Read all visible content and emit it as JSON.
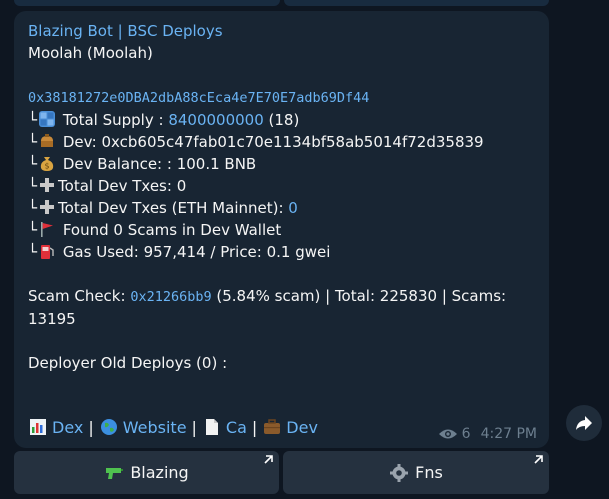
{
  "message": {
    "bot_name": "Blazing Bot | BSC Deploys",
    "token_name": "Moolah (Moolah)",
    "contract_address": "0x38181272e0DBA2dbA88cEca4e7E70E7adb69Df44",
    "tree_mark": "└",
    "lines": {
      "total_supply_label": "Total Supply : ",
      "total_supply_value": "8400000000",
      "total_supply_suffix": " (18)",
      "dev_label": "Dev: ",
      "dev_value": "0xcb605c47fab01c70e1134bf58ab5014f72d35839",
      "dev_balance_label": "Dev Balance: ",
      "dev_balance_value": ": 100.1 BNB",
      "total_dev_txes_label": "Total Dev Txes: ",
      "total_dev_txes_value": "0",
      "total_dev_txes_eth_label": "Total Dev Txes (ETH Mainnet): ",
      "total_dev_txes_eth_value": "0",
      "found_scams": "Found 0 Scams in Dev Wallet",
      "gas_label": "Gas Used: ",
      "gas_value": "957,414 / Price: 0.1 gwei"
    },
    "scam_check": {
      "label": "Scam Check: ",
      "hash": "0x21266bb9",
      "rest": " (5.84% scam) | Total: 225830 | Scams:",
      "scams_count": "13195"
    },
    "deployer_old": "Deployer Old Deploys (0) :",
    "links": {
      "dex": "Dex",
      "website": "Website",
      "ca": "Ca",
      "dev": "Dev",
      "separator": "|"
    },
    "views": "6",
    "time": "4:27 PM"
  },
  "keyboard": {
    "left_label": "Blazing",
    "right_label": "Fns"
  },
  "colors": {
    "background": "#0e1621",
    "bubble": "#182533",
    "link": "#6ab3f3",
    "meta": "#6d7f8f",
    "button": "#25313f"
  },
  "icons": [
    "numbers-icon",
    "moneybag-icon",
    "dollar-bag-icon",
    "plus-icon",
    "flag-icon",
    "fuel-icon",
    "chart-icon",
    "globe-icon",
    "document-icon",
    "briefcase-icon",
    "eye-icon",
    "share-arrow-icon",
    "water-gun-icon",
    "gear-icon",
    "external-arrow-icon"
  ]
}
